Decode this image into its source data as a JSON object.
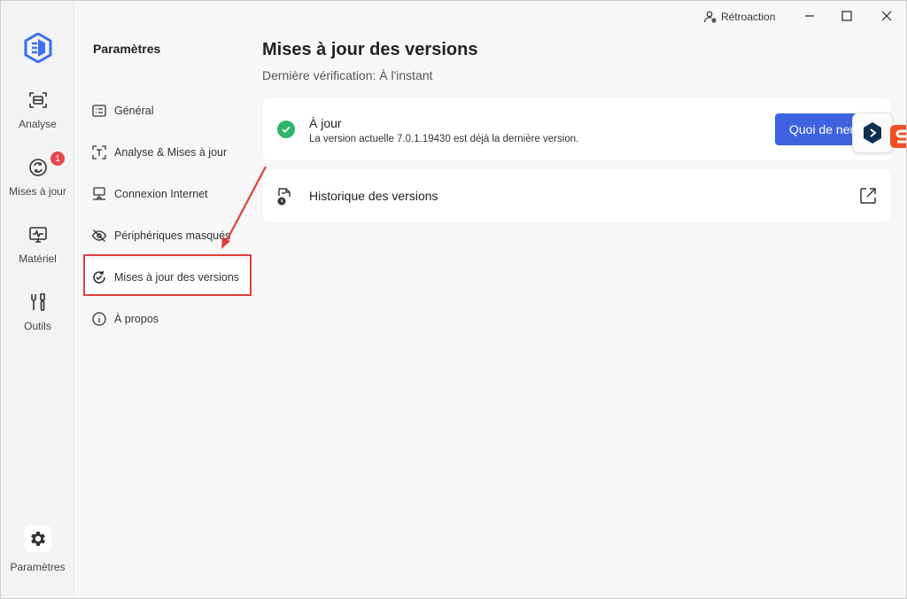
{
  "titlebar": {
    "feedback_label": "Rétroaction"
  },
  "rail": {
    "items": [
      {
        "label": "Analyse",
        "icon": "scan-icon"
      },
      {
        "label": "Mises à jour",
        "icon": "update-icon",
        "badge": "1"
      },
      {
        "label": "Matériel",
        "icon": "hardware-icon"
      },
      {
        "label": "Outils",
        "icon": "tools-icon"
      }
    ],
    "settings_label": "Paramètres"
  },
  "sidebar": {
    "title": "Paramètres",
    "items": [
      {
        "label": "Général",
        "icon": "general-icon"
      },
      {
        "label": "Analyse & Mises à jour",
        "icon": "scan-update-icon"
      },
      {
        "label": "Connexion Internet",
        "icon": "network-icon"
      },
      {
        "label": "Périphériques masqués",
        "icon": "hidden-eye-icon"
      },
      {
        "label": "Mises à jour des versions",
        "icon": "version-update-icon",
        "active": true
      },
      {
        "label": "À propos",
        "icon": "info-icon"
      }
    ]
  },
  "main": {
    "title": "Mises à jour des versions",
    "subtitle": "Dernière vérification: À l'instant",
    "status": {
      "title": "À jour",
      "description": "La version actuelle 7.0.1.19430 est déjà la dernière version.",
      "button_label": "Quoi de neuf"
    },
    "history": {
      "title": "Historique des versions"
    }
  },
  "colors": {
    "accent": "#3f63e0",
    "success": "#2fb56b",
    "badge": "#e5484d",
    "annotation": "#e0403a"
  }
}
